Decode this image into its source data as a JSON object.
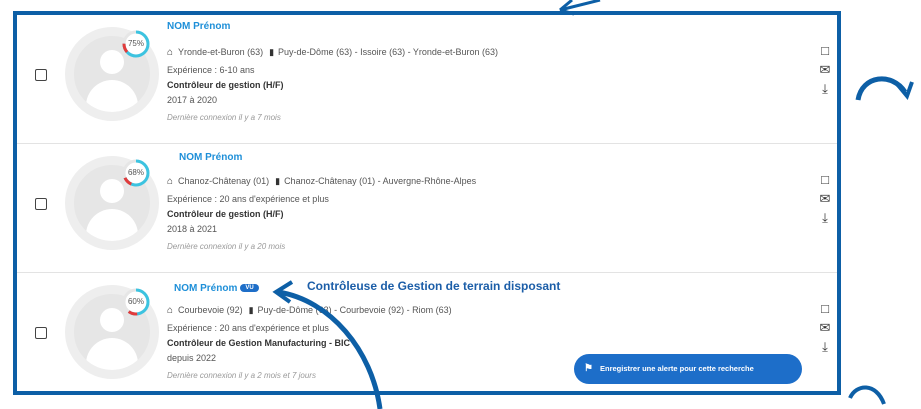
{
  "results": [
    {
      "name": "NOM Prénom",
      "score": 75,
      "score_label": "75%",
      "location": "Yronde-et-Buron (63)",
      "mobility": "Puy-de-Dôme (63) - Issoire (63) - Yronde-et-Buron (63)",
      "experience": "Expérience : 6-10 ans",
      "title": "Contrôleur de gestion (H/F)",
      "dates": "2017 à 2020",
      "last_login": "Dernière connexion il y a 7 mois"
    },
    {
      "name": "NOM Prénom",
      "score": 68,
      "score_label": "68%",
      "location": "Chanoz-Châtenay (01)",
      "mobility": "Chanoz-Châtenay (01) - Auvergne-Rhône-Alpes",
      "experience": "Expérience : 20 ans d'expérience et plus",
      "title": "Contrôleur de gestion (H/F)",
      "dates": "2018 à 2021",
      "last_login": "Dernière connexion il y a 20 mois"
    },
    {
      "name": "NOM Prénom",
      "badge": "VU",
      "score": 60,
      "score_label": "60%",
      "location": "Courbevoie (92)",
      "mobility": "Puy-de-Dôme (63) - Courbevoie (92) - Riom (63)",
      "experience": "Expérience : 20 ans d'expérience et plus",
      "title": "Contrôleur de Gestion Manufacturing - BIC",
      "dates": "depuis 2022",
      "last_login": "Dernière connexion il y a 2 mois et 7 jours"
    }
  ],
  "overlay_caption": "Contrôleuse de Gestion de terrain disposant",
  "alert_button": {
    "label": "Enregistrer une alerte pour cette recherche"
  },
  "icons": {
    "home": "home-icon",
    "mobility": "briefcase-icon",
    "message": "message-icon",
    "email": "envelope-icon",
    "download": "download-icon",
    "alert": "bell-icon"
  },
  "colors": {
    "frame": "#0d5fa6",
    "name": "#1e8fd8",
    "score_ring": "#3cc3e0",
    "score_low": "#e23b3b",
    "button": "#1d6ec9",
    "caption": "#1c5ea8"
  }
}
